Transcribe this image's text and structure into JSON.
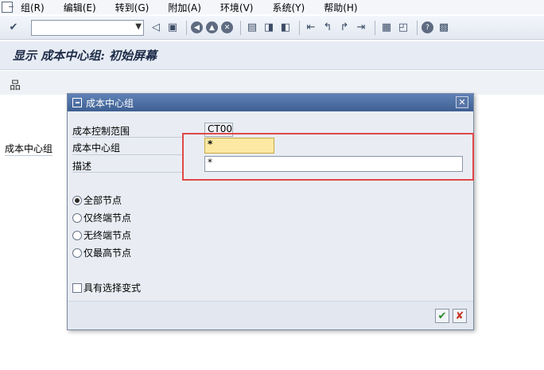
{
  "menubar": {
    "items": [
      "组(R)",
      "编辑(E)",
      "转到(G)",
      "附加(A)",
      "环境(V)",
      "系统(Y)",
      "帮助(H)"
    ]
  },
  "toolbar": {
    "command_field_value": "",
    "icons": [
      "enter-icon",
      "back-icon",
      "save-icon",
      "exit-icon",
      "cancel-icon",
      "print-icon",
      "find-icon",
      "find-next-icon",
      "first-page-icon",
      "previous-page-icon",
      "next-page-icon",
      "last-page-icon",
      "layout-icon",
      "shortcut-icon",
      "help-icon",
      "settings-icon"
    ]
  },
  "page": {
    "title": "显示 成本中心组: 初始屏幕",
    "background_label": "成本中心组"
  },
  "dialog": {
    "title": "成本中心组",
    "fields": {
      "controlling_area_label": "成本控制范围",
      "controlling_area_value": "CT00",
      "cost_center_group_label": "成本中心组",
      "cost_center_group_value": "*",
      "description_label": "描述",
      "description_value": "*"
    },
    "radios": [
      {
        "label": "全部节点",
        "checked": true
      },
      {
        "label": "仅终端节点",
        "checked": false
      },
      {
        "label": "无终端节点",
        "checked": false
      },
      {
        "label": "仅最高节点",
        "checked": false
      }
    ],
    "checkbox": {
      "label": "具有选择变式",
      "checked": false
    },
    "buttons": {
      "ok": "✔",
      "cancel": "✘"
    }
  },
  "colors": {
    "dialog_header": "#4a6ea2",
    "highlight": "#e04848",
    "input_required": "#fde9a2"
  }
}
